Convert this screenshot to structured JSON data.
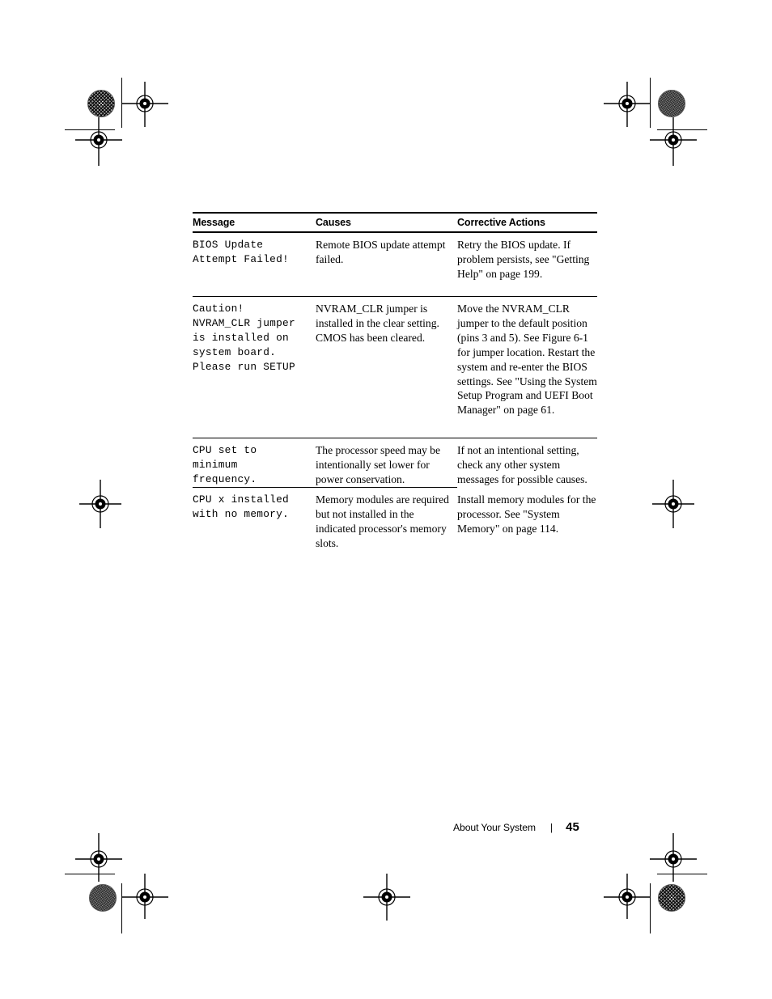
{
  "document": {
    "table": {
      "headers": [
        "Message",
        "Causes",
        "Corrective Actions"
      ],
      "rows": [
        {
          "message": "BIOS Update\nAttempt Failed!",
          "cause": "Remote BIOS update attempt failed.",
          "action": "Retry the BIOS update. If problem persists, see \"Getting Help\" on page 199."
        },
        {
          "message": "Caution!\nNVRAM_CLR jumper\nis installed on\nsystem board.\nPlease run SETUP",
          "cause": "NVRAM_CLR jumper is installed in the clear setting. CMOS has been cleared.",
          "action": "Move the NVRAM_CLR jumper to the default position (pins 3 and 5). See Figure 6-1 for jumper location. Restart the system and re-enter the BIOS settings. See \"Using the System Setup Program and UEFI Boot Manager\" on page 61."
        },
        {
          "message": "CPU set to\nminimum\nfrequency.",
          "cause": "The processor speed may be intentionally set lower for power conservation.",
          "action": "If not an intentional setting, check any other system messages for possible causes."
        },
        {
          "message": "CPU x installed\nwith no memory.",
          "cause": "Memory modules are required but not installed in the indicated processor's memory slots.",
          "action": "Install memory modules for the processor. See \"System Memory\" on page 114."
        }
      ]
    },
    "footer": {
      "section": "About Your System",
      "separator": "|",
      "page_number": "45"
    }
  }
}
